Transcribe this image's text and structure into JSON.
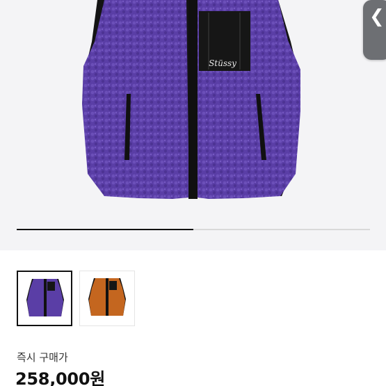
{
  "product": {
    "brand_mark": "Stüssy",
    "colors": {
      "vest_purple": "#5a3ea6",
      "vest_brown": "#c4661f",
      "trim": "#111111"
    }
  },
  "gallery": {
    "back_icon": "chevron-left-icon",
    "back_glyph": "❮",
    "progress_fraction": 0.5,
    "thumbnails": [
      {
        "name": "purple-vest-thumb",
        "color": "#5a3ea6",
        "selected": true
      },
      {
        "name": "brown-vest-thumb",
        "color": "#c4661f",
        "selected": false
      }
    ]
  },
  "pricing": {
    "label": "즉시 구매가",
    "price": "258,000원"
  }
}
